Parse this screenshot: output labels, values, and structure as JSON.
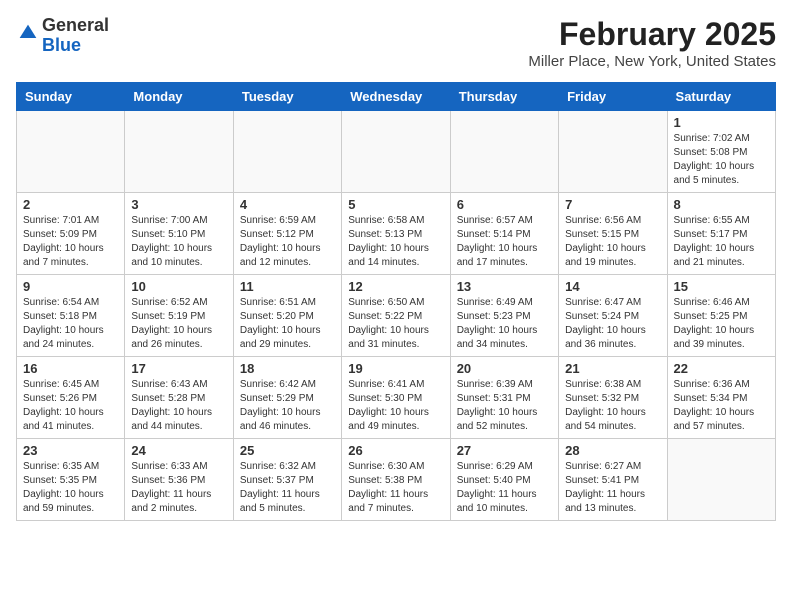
{
  "header": {
    "logo": {
      "line1": "General",
      "line2": "Blue"
    },
    "title": "February 2025",
    "location": "Miller Place, New York, United States"
  },
  "weekdays": [
    "Sunday",
    "Monday",
    "Tuesday",
    "Wednesday",
    "Thursday",
    "Friday",
    "Saturday"
  ],
  "weeks": [
    [
      {
        "day": "",
        "info": ""
      },
      {
        "day": "",
        "info": ""
      },
      {
        "day": "",
        "info": ""
      },
      {
        "day": "",
        "info": ""
      },
      {
        "day": "",
        "info": ""
      },
      {
        "day": "",
        "info": ""
      },
      {
        "day": "1",
        "info": "Sunrise: 7:02 AM\nSunset: 5:08 PM\nDaylight: 10 hours and 5 minutes."
      }
    ],
    [
      {
        "day": "2",
        "info": "Sunrise: 7:01 AM\nSunset: 5:09 PM\nDaylight: 10 hours and 7 minutes."
      },
      {
        "day": "3",
        "info": "Sunrise: 7:00 AM\nSunset: 5:10 PM\nDaylight: 10 hours and 10 minutes."
      },
      {
        "day": "4",
        "info": "Sunrise: 6:59 AM\nSunset: 5:12 PM\nDaylight: 10 hours and 12 minutes."
      },
      {
        "day": "5",
        "info": "Sunrise: 6:58 AM\nSunset: 5:13 PM\nDaylight: 10 hours and 14 minutes."
      },
      {
        "day": "6",
        "info": "Sunrise: 6:57 AM\nSunset: 5:14 PM\nDaylight: 10 hours and 17 minutes."
      },
      {
        "day": "7",
        "info": "Sunrise: 6:56 AM\nSunset: 5:15 PM\nDaylight: 10 hours and 19 minutes."
      },
      {
        "day": "8",
        "info": "Sunrise: 6:55 AM\nSunset: 5:17 PM\nDaylight: 10 hours and 21 minutes."
      }
    ],
    [
      {
        "day": "9",
        "info": "Sunrise: 6:54 AM\nSunset: 5:18 PM\nDaylight: 10 hours and 24 minutes."
      },
      {
        "day": "10",
        "info": "Sunrise: 6:52 AM\nSunset: 5:19 PM\nDaylight: 10 hours and 26 minutes."
      },
      {
        "day": "11",
        "info": "Sunrise: 6:51 AM\nSunset: 5:20 PM\nDaylight: 10 hours and 29 minutes."
      },
      {
        "day": "12",
        "info": "Sunrise: 6:50 AM\nSunset: 5:22 PM\nDaylight: 10 hours and 31 minutes."
      },
      {
        "day": "13",
        "info": "Sunrise: 6:49 AM\nSunset: 5:23 PM\nDaylight: 10 hours and 34 minutes."
      },
      {
        "day": "14",
        "info": "Sunrise: 6:47 AM\nSunset: 5:24 PM\nDaylight: 10 hours and 36 minutes."
      },
      {
        "day": "15",
        "info": "Sunrise: 6:46 AM\nSunset: 5:25 PM\nDaylight: 10 hours and 39 minutes."
      }
    ],
    [
      {
        "day": "16",
        "info": "Sunrise: 6:45 AM\nSunset: 5:26 PM\nDaylight: 10 hours and 41 minutes."
      },
      {
        "day": "17",
        "info": "Sunrise: 6:43 AM\nSunset: 5:28 PM\nDaylight: 10 hours and 44 minutes."
      },
      {
        "day": "18",
        "info": "Sunrise: 6:42 AM\nSunset: 5:29 PM\nDaylight: 10 hours and 46 minutes."
      },
      {
        "day": "19",
        "info": "Sunrise: 6:41 AM\nSunset: 5:30 PM\nDaylight: 10 hours and 49 minutes."
      },
      {
        "day": "20",
        "info": "Sunrise: 6:39 AM\nSunset: 5:31 PM\nDaylight: 10 hours and 52 minutes."
      },
      {
        "day": "21",
        "info": "Sunrise: 6:38 AM\nSunset: 5:32 PM\nDaylight: 10 hours and 54 minutes."
      },
      {
        "day": "22",
        "info": "Sunrise: 6:36 AM\nSunset: 5:34 PM\nDaylight: 10 hours and 57 minutes."
      }
    ],
    [
      {
        "day": "23",
        "info": "Sunrise: 6:35 AM\nSunset: 5:35 PM\nDaylight: 10 hours and 59 minutes."
      },
      {
        "day": "24",
        "info": "Sunrise: 6:33 AM\nSunset: 5:36 PM\nDaylight: 11 hours and 2 minutes."
      },
      {
        "day": "25",
        "info": "Sunrise: 6:32 AM\nSunset: 5:37 PM\nDaylight: 11 hours and 5 minutes."
      },
      {
        "day": "26",
        "info": "Sunrise: 6:30 AM\nSunset: 5:38 PM\nDaylight: 11 hours and 7 minutes."
      },
      {
        "day": "27",
        "info": "Sunrise: 6:29 AM\nSunset: 5:40 PM\nDaylight: 11 hours and 10 minutes."
      },
      {
        "day": "28",
        "info": "Sunrise: 6:27 AM\nSunset: 5:41 PM\nDaylight: 11 hours and 13 minutes."
      },
      {
        "day": "",
        "info": ""
      }
    ]
  ]
}
